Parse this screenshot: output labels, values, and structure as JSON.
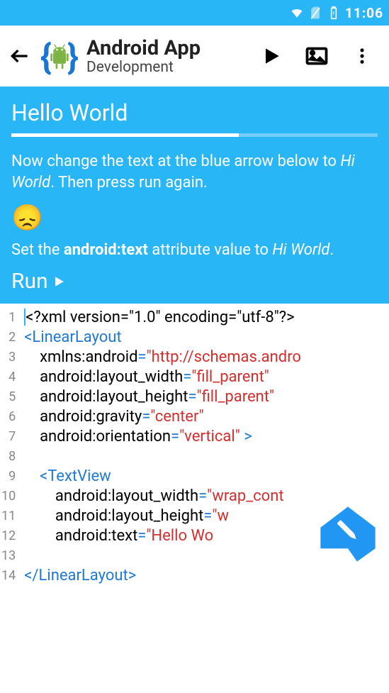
{
  "status": {
    "time": "11:06"
  },
  "appbar": {
    "title": "Android App",
    "subtitle": "Development"
  },
  "lesson": {
    "title": "Hello World",
    "instr_pre": "Now change the text at the blue arrow below to ",
    "instr_em": "Hi World",
    "instr_post": ". Then press run again.",
    "emoji": "😞",
    "hint_pre": "Set the ",
    "hint_bold": "android:text",
    "hint_mid": " attribute value to ",
    "hint_em": "Hi World",
    "hint_post": ".",
    "run_label": "Run"
  },
  "code": {
    "lines": [
      "1",
      "2",
      "3",
      "4",
      "5",
      "6",
      "7",
      "8",
      "9",
      "10",
      "11",
      "12",
      "13",
      "14"
    ],
    "l1": "<?xml version=\"1.0\" encoding=\"utf-8\"?>",
    "l2_tag": "<LinearLayout",
    "l3_attr": "xmlns:android",
    "l3_val": "\"http://schemas.andro",
    "l4_attr": "android:layout_width",
    "l4_val": "\"fill_parent\"",
    "l5_attr": "android:layout_height",
    "l5_val": "\"fill_parent\"",
    "l6_attr": "android:gravity",
    "l6_val": "\"center\"",
    "l7_attr": "android:orientation",
    "l7_val": "\"vertical\"",
    "l7_end": " >",
    "l9_tag": "<TextView",
    "l10_attr": "android:layout_width",
    "l10_val": "\"wrap_cont",
    "l11_attr": "android:layout_height",
    "l11_val": "\"w",
    "l12_attr": "android:text",
    "l12_val": "\"Hello Wo",
    "l14_tag": "</LinearLayout>"
  }
}
